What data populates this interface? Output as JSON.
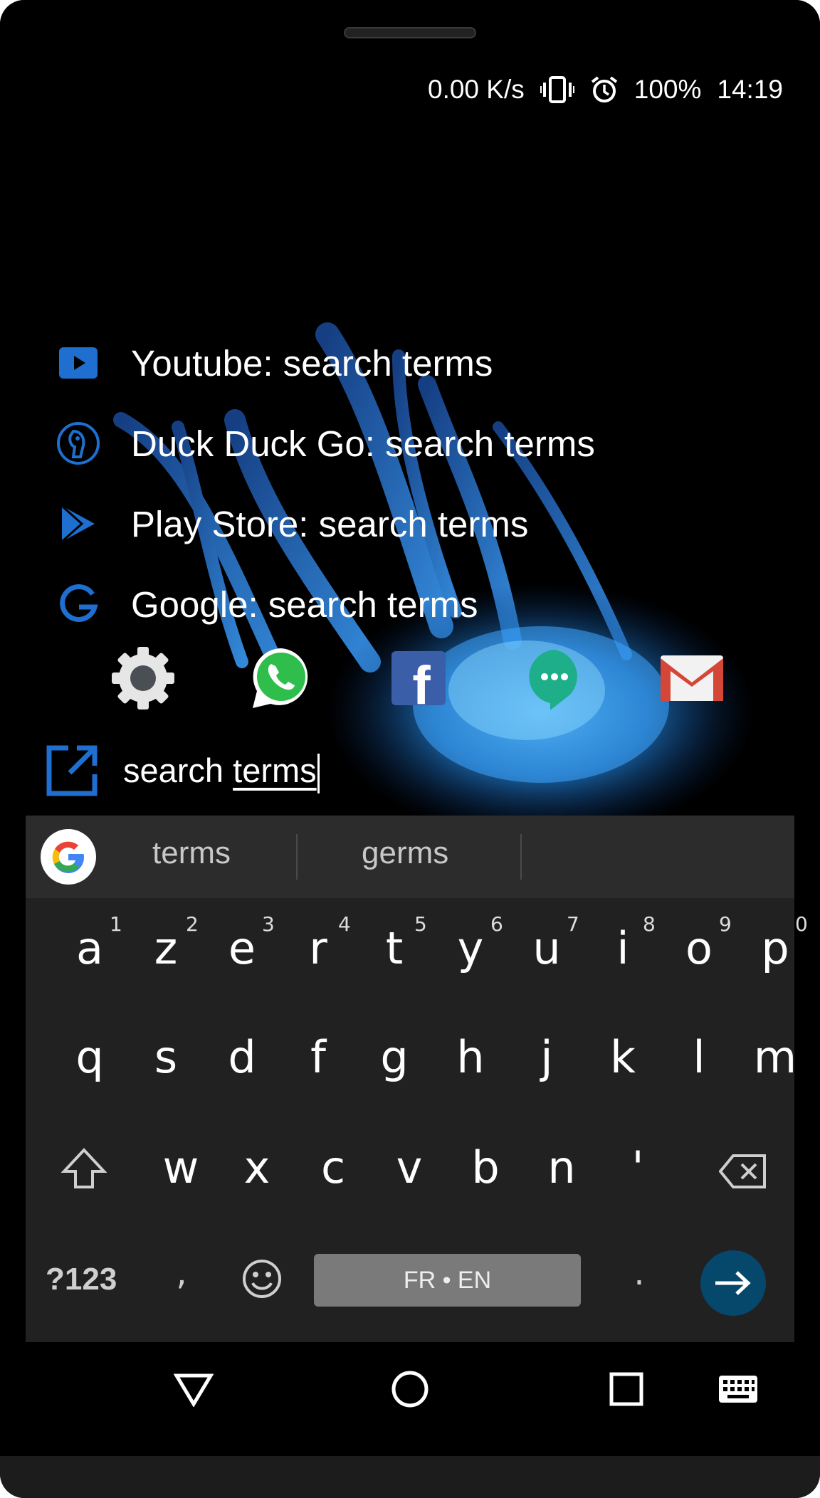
{
  "status_bar": {
    "net_speed": "0.00 K/s",
    "battery": "100%",
    "time": "14:19"
  },
  "suggestions": [
    {
      "label": "Youtube: search terms",
      "icon": "youtube-icon"
    },
    {
      "label": "Duck Duck Go: search terms",
      "icon": "duckduckgo-icon"
    },
    {
      "label": "Play Store: search terms",
      "icon": "play-store-icon"
    },
    {
      "label": "Google: search terms",
      "icon": "google-icon"
    }
  ],
  "apps": [
    {
      "name": "settings-app-icon"
    },
    {
      "name": "whatsapp-app-icon"
    },
    {
      "name": "facebook-app-icon",
      "letter": "f"
    },
    {
      "name": "hangouts-app-icon"
    },
    {
      "name": "gmail-app-icon"
    }
  ],
  "search": {
    "word1": "search",
    "word2": "terms"
  },
  "keyboard": {
    "suggestions": [
      "terms",
      "germs"
    ],
    "row1": [
      "a",
      "z",
      "e",
      "r",
      "t",
      "y",
      "u",
      "i",
      "o",
      "p"
    ],
    "row1_hints": [
      "1",
      "2",
      "3",
      "4",
      "5",
      "6",
      "7",
      "8",
      "9",
      "0"
    ],
    "row2": [
      "q",
      "s",
      "d",
      "f",
      "g",
      "h",
      "j",
      "k",
      "l",
      "m"
    ],
    "row3": [
      "w",
      "x",
      "c",
      "v",
      "b",
      "n",
      "'"
    ],
    "symbols": "?123",
    "comma": ",",
    "space": "FR • EN",
    "period": ".",
    "colors": {
      "background": "#212121",
      "enter": "#06476c",
      "accent_blue": "#1e6fd0"
    }
  }
}
